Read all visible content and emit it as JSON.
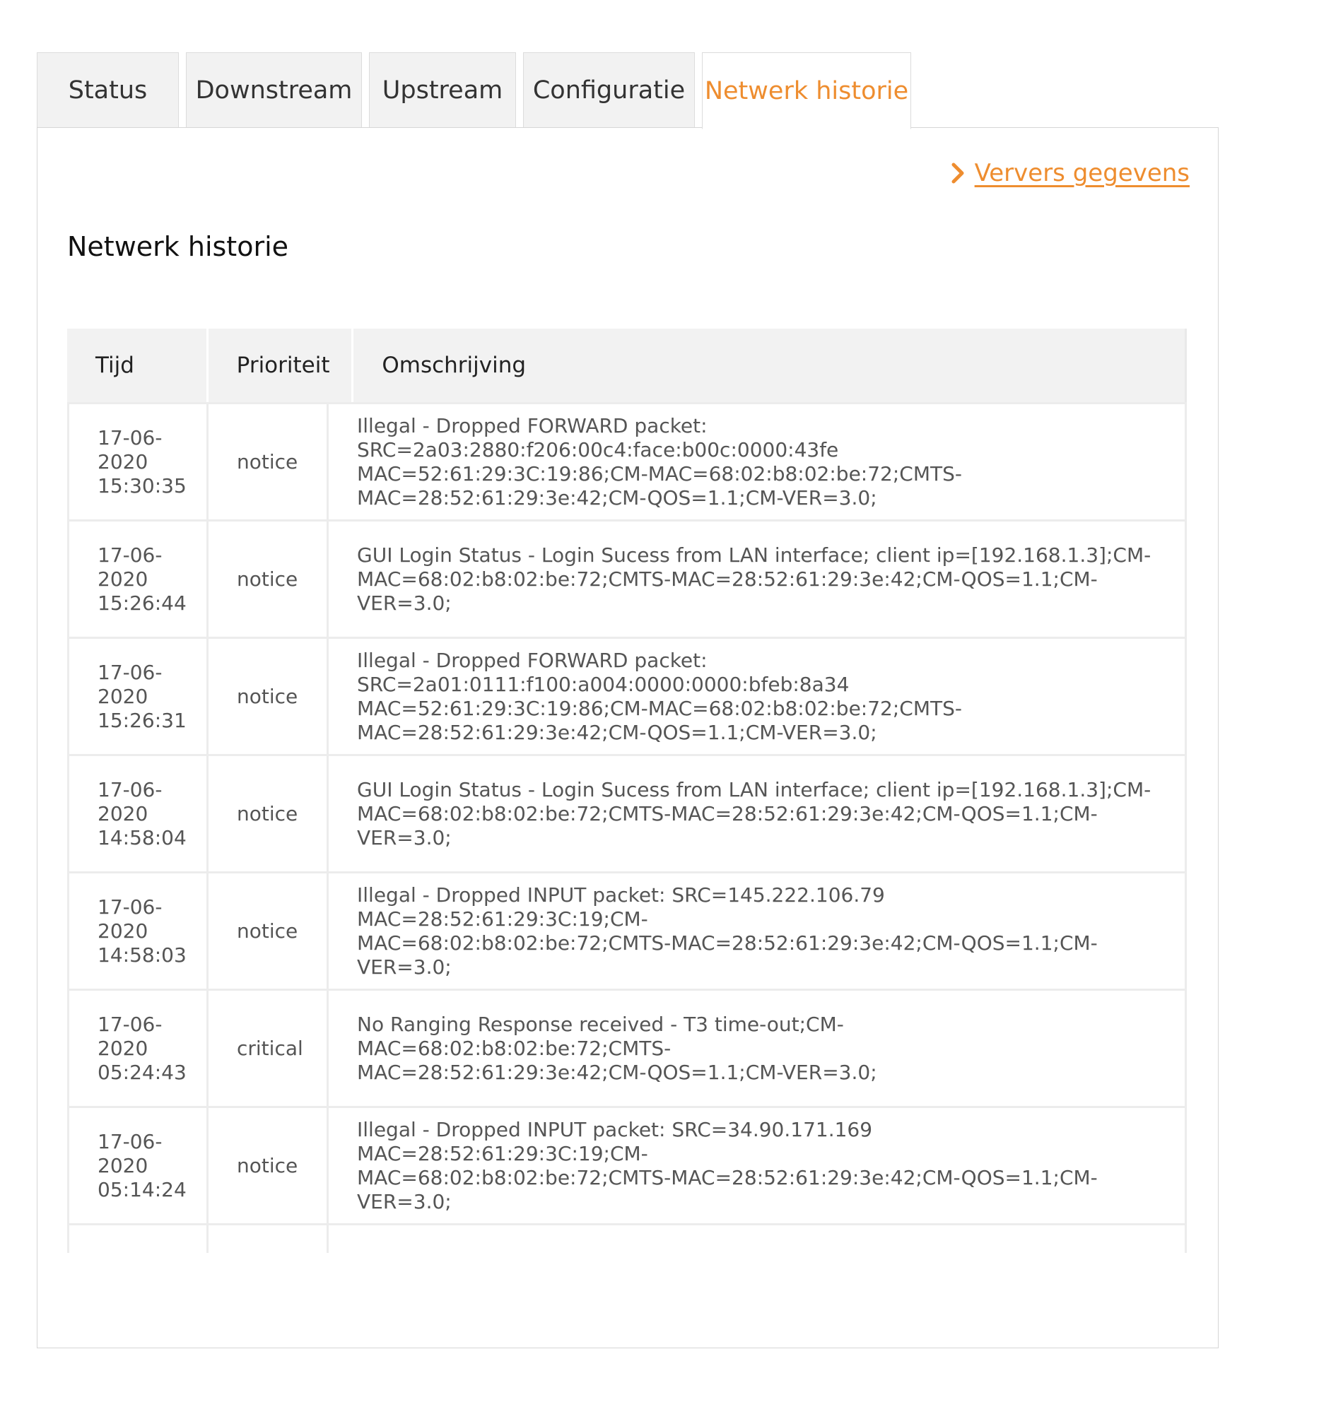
{
  "tabs": [
    {
      "label": "Status",
      "active": false
    },
    {
      "label": "Downstream",
      "active": false
    },
    {
      "label": "Upstream",
      "active": false
    },
    {
      "label": "Configuratie",
      "active": false
    },
    {
      "label": "Netwerk historie",
      "active": true
    }
  ],
  "refresh_label": "Ververs gegevens",
  "section_title": "Netwerk historie",
  "colors": {
    "accent": "#ee8d2f",
    "tab_bg": "#f2f2f2",
    "border": "#d6d6d6",
    "header_bg": "#f2f2f2"
  },
  "icons": {
    "refresh": "chevron-right-icon"
  },
  "table": {
    "headers": [
      "Tijd",
      "Prioriteit",
      "Omschrijving"
    ],
    "rows": [
      {
        "time": "17-06-\n2020\n15:30:35",
        "priority": "notice",
        "description": "Illegal - Dropped FORWARD packet: SRC=2a03:2880:f206:00c4:face:b00c:0000:43fe\nMAC=52:61:29:3C:19:86;CM-MAC=68:02:b8:02:be:72;CMTS-\nMAC=28:52:61:29:3e:42;CM-QOS=1.1;CM-VER=3.0;"
      },
      {
        "time": "17-06-\n2020\n15:26:44",
        "priority": "notice",
        "description": "GUI Login Status - Login Sucess from LAN interface; client ip=[192.168.1.3];CM-\nMAC=68:02:b8:02:be:72;CMTS-MAC=28:52:61:29:3e:42;CM-QOS=1.1;CM-VER=3.0;"
      },
      {
        "time": "17-06-\n2020\n15:26:31",
        "priority": "notice",
        "description": "Illegal - Dropped FORWARD packet: SRC=2a01:0111:f100:a004:0000:0000:bfeb:8a34\nMAC=52:61:29:3C:19:86;CM-MAC=68:02:b8:02:be:72;CMTS-\nMAC=28:52:61:29:3e:42;CM-QOS=1.1;CM-VER=3.0;"
      },
      {
        "time": "17-06-\n2020\n14:58:04",
        "priority": "notice",
        "description": "GUI Login Status - Login Sucess from LAN interface; client ip=[192.168.1.3];CM-\nMAC=68:02:b8:02:be:72;CMTS-MAC=28:52:61:29:3e:42;CM-QOS=1.1;CM-VER=3.0;"
      },
      {
        "time": "17-06-\n2020\n14:58:03",
        "priority": "notice",
        "description": "Illegal - Dropped INPUT packet: SRC=145.222.106.79 MAC=28:52:61:29:3C:19;CM-\nMAC=68:02:b8:02:be:72;CMTS-MAC=28:52:61:29:3e:42;CM-QOS=1.1;CM-VER=3.0;"
      },
      {
        "time": "17-06-\n2020\n05:24:43",
        "priority": "critical",
        "description": "No Ranging Response received - T3 time-out;CM-MAC=68:02:b8:02:be:72;CMTS-\nMAC=28:52:61:29:3e:42;CM-QOS=1.1;CM-VER=3.0;"
      },
      {
        "time": "17-06-\n2020\n05:14:24",
        "priority": "notice",
        "description": "Illegal - Dropped INPUT packet: SRC=34.90.171.169 MAC=28:52:61:29:3C:19;CM-\nMAC=68:02:b8:02:be:72;CMTS-MAC=28:52:61:29:3e:42;CM-QOS=1.1;CM-VER=3.0;"
      },
      {
        "time": "",
        "priority": "",
        "description": ""
      }
    ]
  }
}
